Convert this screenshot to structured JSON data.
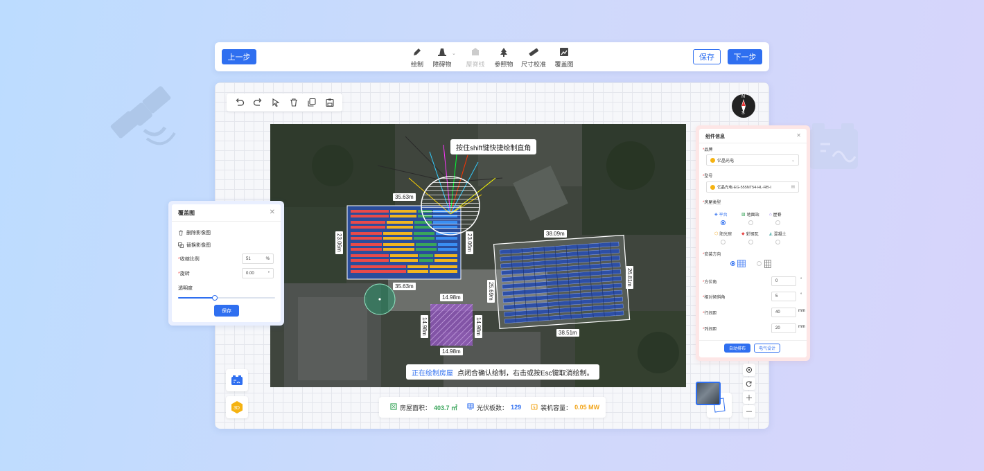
{
  "toolbar": {
    "prev_label": "上一步",
    "save_label": "保存",
    "next_label": "下一步",
    "tools": [
      {
        "label": "绘制",
        "icon": "pen-icon",
        "disabled": false
      },
      {
        "label": "障碍物",
        "icon": "obstacle-icon",
        "disabled": false
      },
      {
        "label": "屋脊线",
        "icon": "ridge-line-icon",
        "disabled": true
      },
      {
        "label": "参照物",
        "icon": "tree-icon",
        "disabled": false
      },
      {
        "label": "尺寸校准",
        "icon": "ruler-icon",
        "disabled": false
      },
      {
        "label": "覆盖图",
        "icon": "overlay-image-icon",
        "disabled": false
      }
    ]
  },
  "edit_tools": [
    "undo-icon",
    "redo-icon",
    "select-cursor-icon",
    "delete-icon",
    "copy-icon",
    "paste-icon"
  ],
  "compass": {
    "north": "N",
    "south": "S"
  },
  "map": {
    "top_tip": "按住shift键快捷绘制直角",
    "bottom_tip_highlight": "正在绘制房屋",
    "bottom_tip_text": "点闭合确认绘制，右击或按Esc键取消绘制。",
    "dims": {
      "a_top": "35.63m",
      "a_bottom": "35.63m",
      "a_left": "23.06m",
      "a_right": "23.06m",
      "b_top": "38.09m",
      "b_bottom": "38.51m",
      "b_left": "25.69m",
      "b_right": "26.81m",
      "c_top": "14.98m",
      "c_bottom": "14.98m",
      "c_left": "14.98m",
      "c_right": "14.98m"
    }
  },
  "stats": {
    "area_label": "房屋面积：",
    "area_value": "403.7 ㎡",
    "panels_label": "光伏板数：",
    "panels_value": "129",
    "capacity_label": "装机容量：",
    "capacity_value": "0.05 MW",
    "colors": {
      "area": "#3aa55b",
      "panels": "#2f6ff0",
      "capacity": "#f2a51a"
    }
  },
  "overlay_panel": {
    "title": "覆盖图",
    "delete_label": "删除影像图",
    "replace_label": "替换影像图",
    "scale_label": "收缩比例",
    "scale_value": "51",
    "scale_unit": "%",
    "rotate_label": "旋转",
    "rotate_value": "0.00",
    "rotate_unit": "°",
    "opacity_label": "透明度",
    "opacity_value": 0.38,
    "save_label": "保存"
  },
  "component_panel": {
    "title": "组件信息",
    "brand_label": "品牌",
    "brand_value": "亿晶光电",
    "model_label": "型号",
    "model_value": "亿晶光电-EG-555NT54-HL-RB-I",
    "roof_type_label": "房屋类型",
    "roof_types": [
      "平台",
      "地面站",
      "屋脊",
      "阳光房",
      "彩钢瓦",
      "混凝土"
    ],
    "roof_selected": "平台",
    "install_dir_label": "安装方向",
    "azimuth_label": "方位角",
    "azimuth_value": "0",
    "azimuth_unit": "°",
    "tilt_label": "相对倾斜角",
    "tilt_value": "5",
    "tilt_unit": "°",
    "row_gap_label": "行间距",
    "row_gap_value": "40",
    "row_gap_unit": "mm",
    "col_gap_label": "列间距",
    "col_gap_value": "20",
    "col_gap_unit": "mm",
    "auto_btn": "自动排布",
    "elec_btn": "电气设计"
  },
  "map_controls": [
    "locate-icon",
    "refresh-icon",
    "zoom-in-icon",
    "zoom-out-icon"
  ]
}
